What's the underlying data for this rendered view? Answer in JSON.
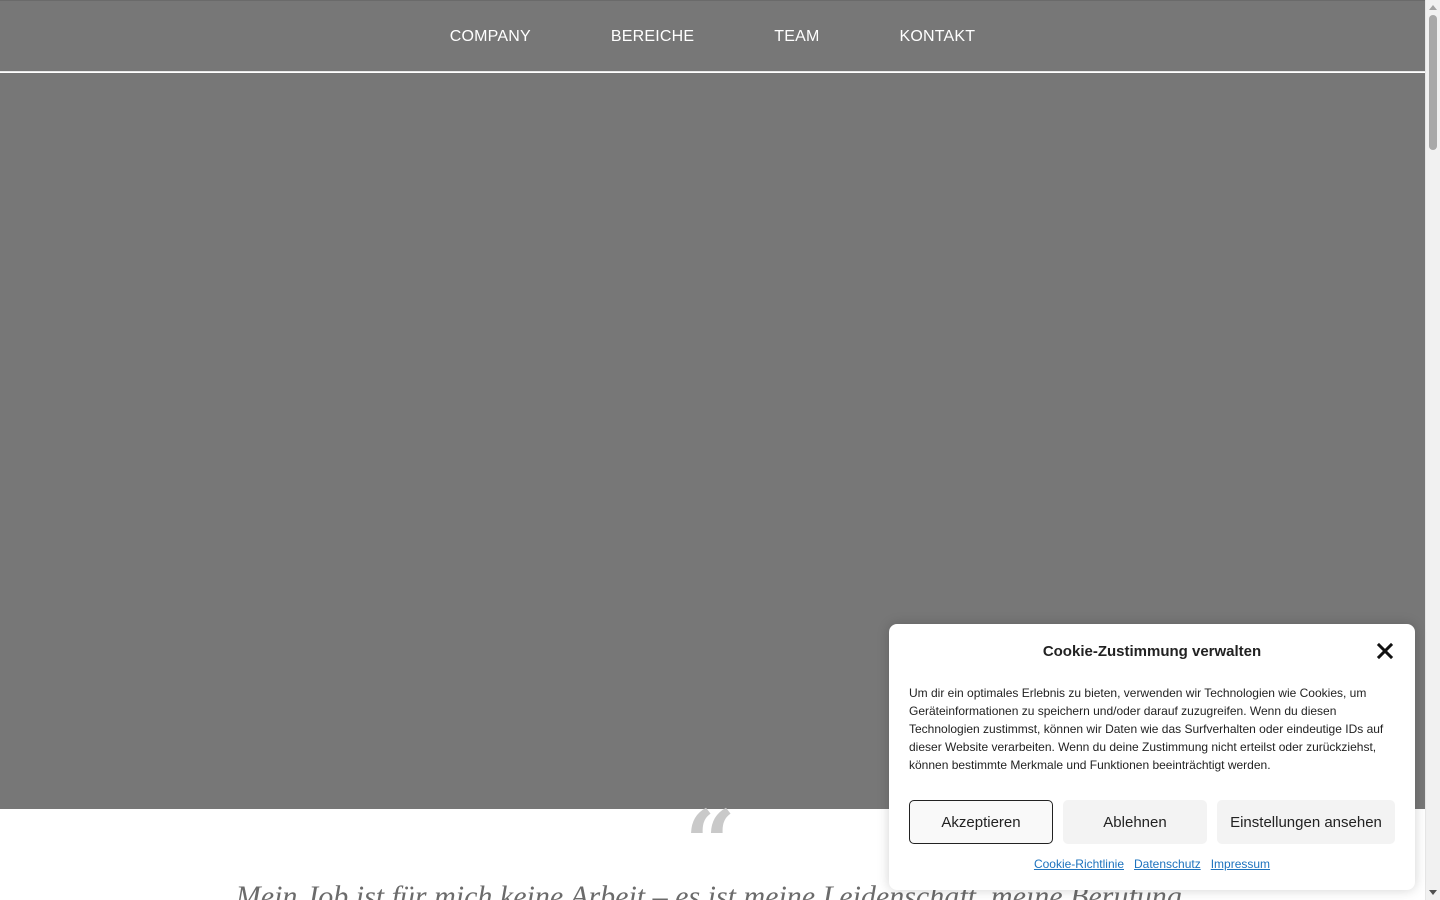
{
  "nav": {
    "items": [
      "COMPANY",
      "BEREICHE",
      "TEAM",
      "KONTAKT"
    ]
  },
  "quote": {
    "mark": "“",
    "text": "Mein Job ist für mich keine Arbeit – es ist meine Leidenschaft, meine Berufung."
  },
  "cookie": {
    "title": "Cookie-Zustimmung verwalten",
    "close_icon": "close-icon",
    "message": "Um dir ein optimales Erlebnis zu bieten, verwenden wir Technologien wie Cookies, um Geräteinformationen zu speichern und/oder darauf zuzugreifen. Wenn du diesen Technologien zustimmst, können wir Daten wie das Surfverhalten oder eindeutige IDs auf dieser Website verarbeiten. Wenn du deine Zustimmung nicht erteilst oder zurückziehst, können bestimmte Merkmale und Funktionen beeinträchtigt werden.",
    "accept_label": "Akzeptieren",
    "deny_label": "Ablehnen",
    "prefs_label": "Einstellungen ansehen",
    "links": [
      "Cookie-Richtlinie",
      "Datenschutz",
      "Impressum"
    ]
  },
  "colors": {
    "header_bg": "#777777",
    "hero_bg": "#777777",
    "link": "#1e73be",
    "quote_mark": "#c9c9c9"
  }
}
